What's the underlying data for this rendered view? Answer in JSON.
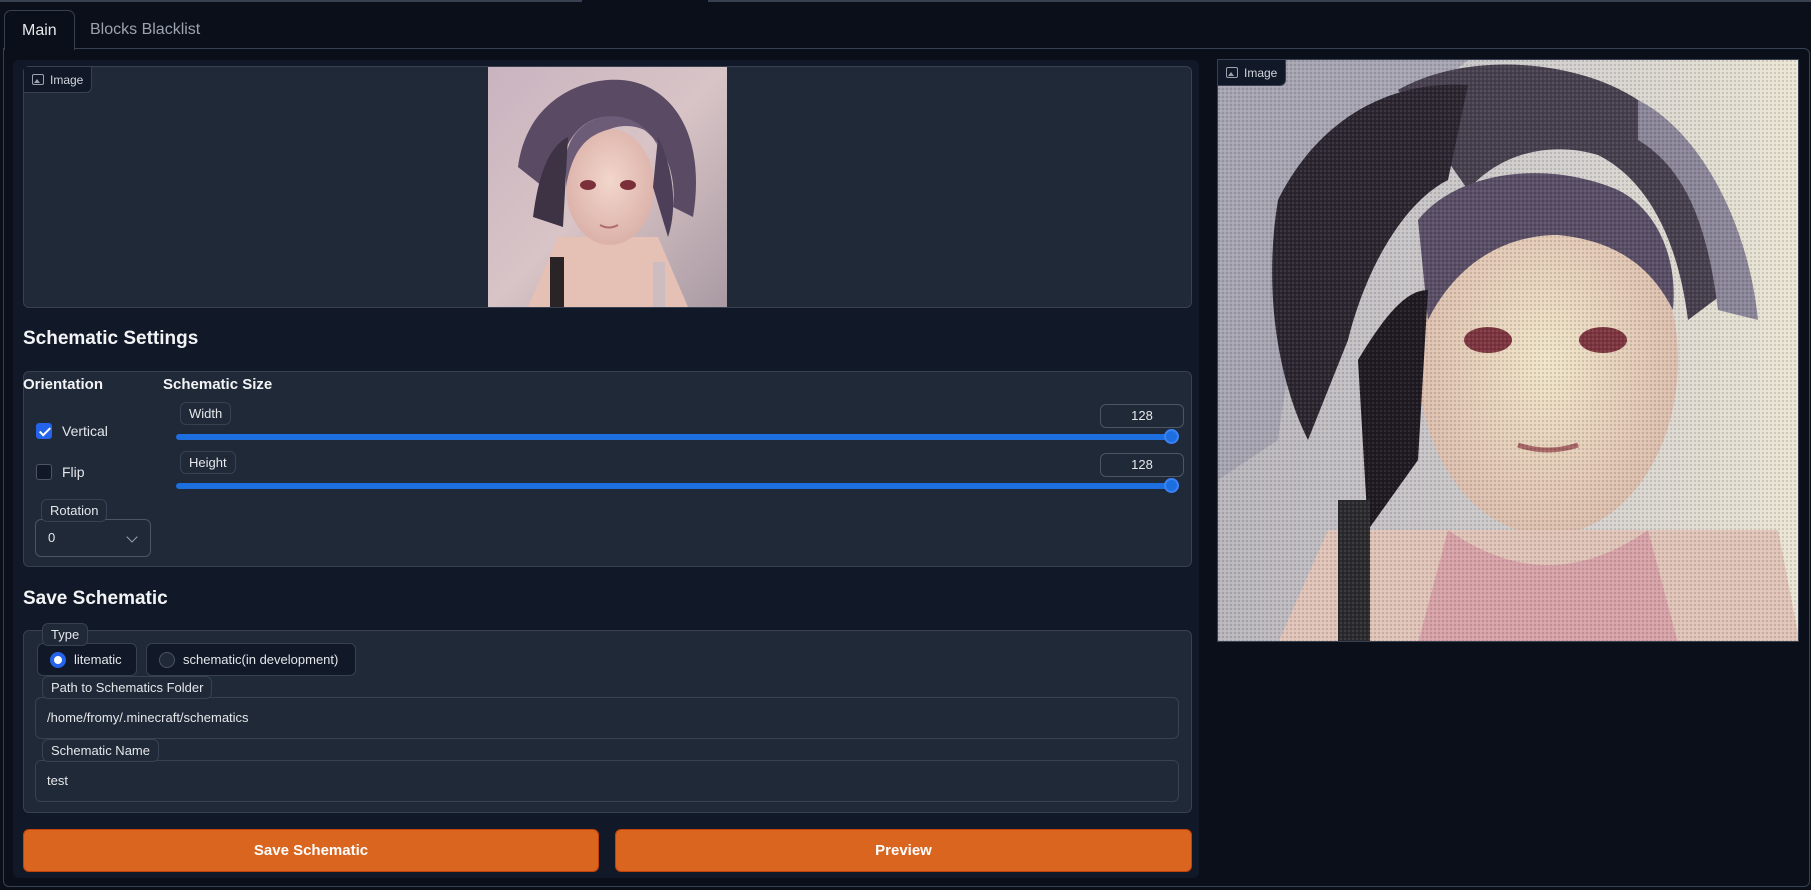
{
  "tabs": [
    {
      "label": "Main",
      "active": true
    },
    {
      "label": "Blocks Blacklist",
      "active": false
    }
  ],
  "input_image": {
    "label": "Image",
    "icon": "image-icon"
  },
  "output_image": {
    "label": "Image",
    "icon": "image-icon"
  },
  "schematic_settings": {
    "title": "Schematic Settings",
    "orientation": {
      "title": "Orientation",
      "vertical": {
        "label": "Vertical",
        "checked": true
      },
      "flip": {
        "label": "Flip",
        "checked": false
      },
      "rotation": {
        "label": "Rotation",
        "value": "0"
      }
    },
    "size": {
      "title": "Schematic Size",
      "width": {
        "label": "Width",
        "value": "128",
        "level": 1.0
      },
      "height": {
        "label": "Height",
        "value": "128",
        "level": 1.0
      }
    }
  },
  "save_schematic": {
    "title": "Save Schematic",
    "type": {
      "label": "Type",
      "options": [
        {
          "label": "litematic",
          "selected": true
        },
        {
          "label": "schematic(in development)",
          "selected": false
        }
      ]
    },
    "path": {
      "label": "Path to Schematics Folder",
      "value": "/home/fromy/.minecraft/schematics"
    },
    "name": {
      "label": "Schematic Name",
      "value": "test"
    }
  },
  "buttons": {
    "save": "Save Schematic",
    "preview": "Preview"
  },
  "colors": {
    "accent": "#d9651f",
    "slider": "#1d6fe0",
    "background": "#0b0f19",
    "panel": "#1f2937"
  }
}
